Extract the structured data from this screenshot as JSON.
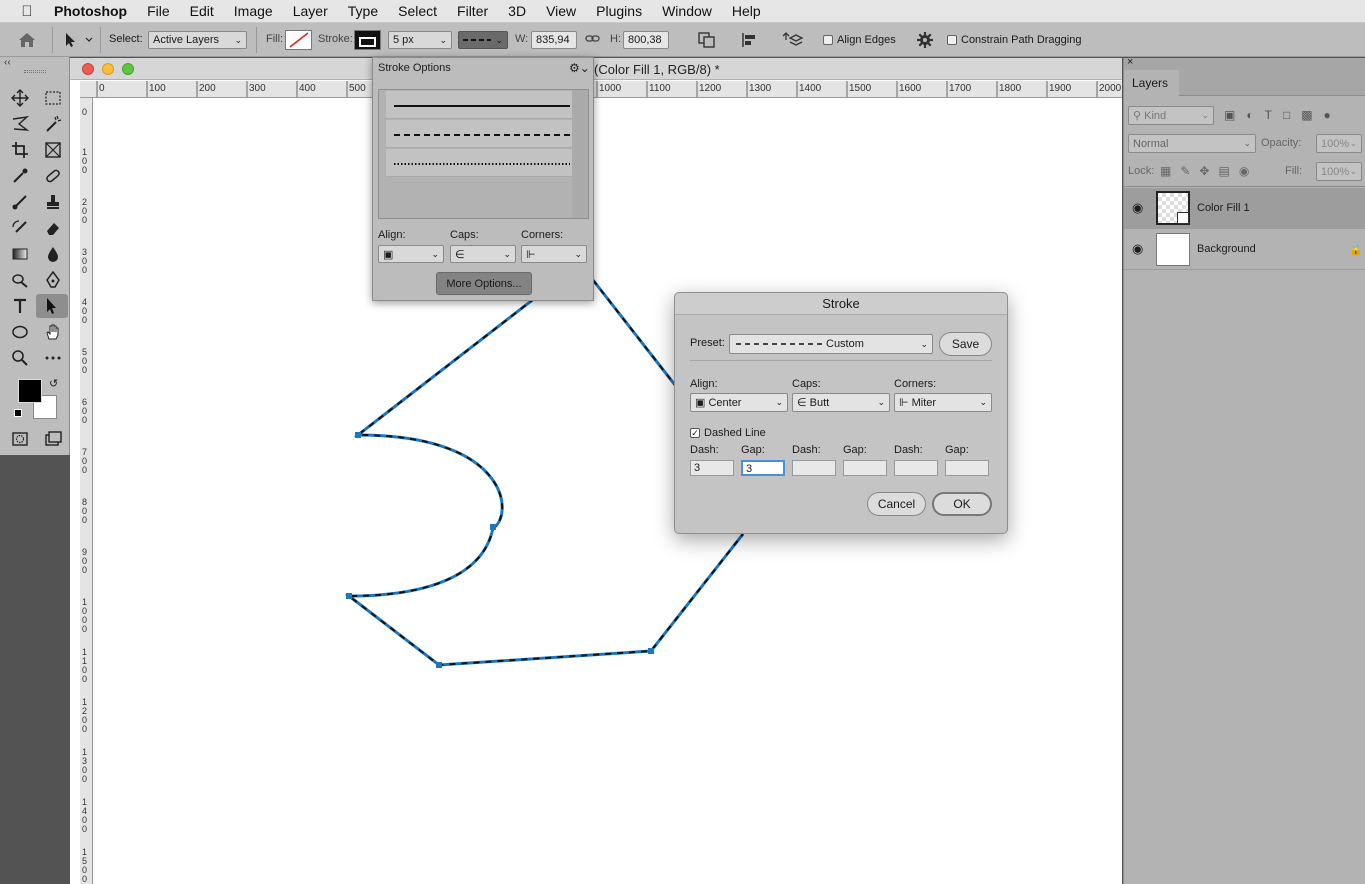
{
  "menubar": {
    "app": "Photoshop",
    "items": [
      "File",
      "Edit",
      "Image",
      "Layer",
      "Type",
      "Select",
      "Filter",
      "3D",
      "View",
      "Plugins",
      "Window",
      "Help"
    ]
  },
  "options": {
    "select_label": "Select:",
    "select_value": "Active Layers",
    "fill_label": "Fill:",
    "stroke_label": "Stroke:",
    "stroke_size": "5 px",
    "w_label": "W:",
    "w_value": "835,94",
    "h_label": "H:",
    "h_value": "800,38",
    "align_edges": "Align Edges",
    "constrain": "Constrain Path Dragging"
  },
  "document": {
    "title": "(Color Fill 1, RGB/8) *"
  },
  "hruler_labels": [
    "0",
    "100",
    "200",
    "300",
    "400",
    "500",
    "1000",
    "1100",
    "1200",
    "1300",
    "1400",
    "1500",
    "1600",
    "1700",
    "1800",
    "1900",
    "2000"
  ],
  "vruler_labels": [
    "1\n0\n0",
    "2\n0\n0",
    "3\n0\n0",
    "4\n0\n0",
    "5\n0\n0",
    "6\n0\n0",
    "7\n0\n0",
    "8\n0\n0",
    "9\n0\n0",
    "1\n0\n0\n0",
    "1\n1\n0\n0",
    "1\n2\n0\n0",
    "1\n3\n0\n0",
    "1\n4\n0\n0",
    "1\n5\n0\n0"
  ],
  "stroke_options_panel": {
    "title": "Stroke Options",
    "align_label": "Align:",
    "caps_label": "Caps:",
    "corners_label": "Corners:",
    "more_button": "More Options..."
  },
  "stroke_dialog": {
    "title": "Stroke",
    "preset_label": "Preset:",
    "preset_value": "Custom",
    "save_button": "Save",
    "align_label": "Align:",
    "align_value": "Center",
    "caps_label": "Caps:",
    "caps_value": "Butt",
    "corners_label": "Corners:",
    "corners_value": "Miter",
    "dashed_label": "Dashed Line",
    "dash_label": "Dash:",
    "gap_label": "Gap:",
    "dash1": "3",
    "gap1": "3",
    "cancel_button": "Cancel",
    "ok_button": "OK"
  },
  "layers_panel": {
    "title": "Layers",
    "kind_placeholder": "Kind",
    "blend_mode": "Normal",
    "opacity_label": "Opacity:",
    "opacity_value": "100%",
    "lock_label": "Lock:",
    "fill_label": "Fill:",
    "fill_value": "100%",
    "layers": [
      {
        "name": "Color Fill 1"
      },
      {
        "name": "Background"
      }
    ]
  },
  "colors": {
    "path_stroke": "#1a78c2",
    "ui_panel": "#bdbdbd",
    "selected_layer": "#9d9d9d"
  }
}
